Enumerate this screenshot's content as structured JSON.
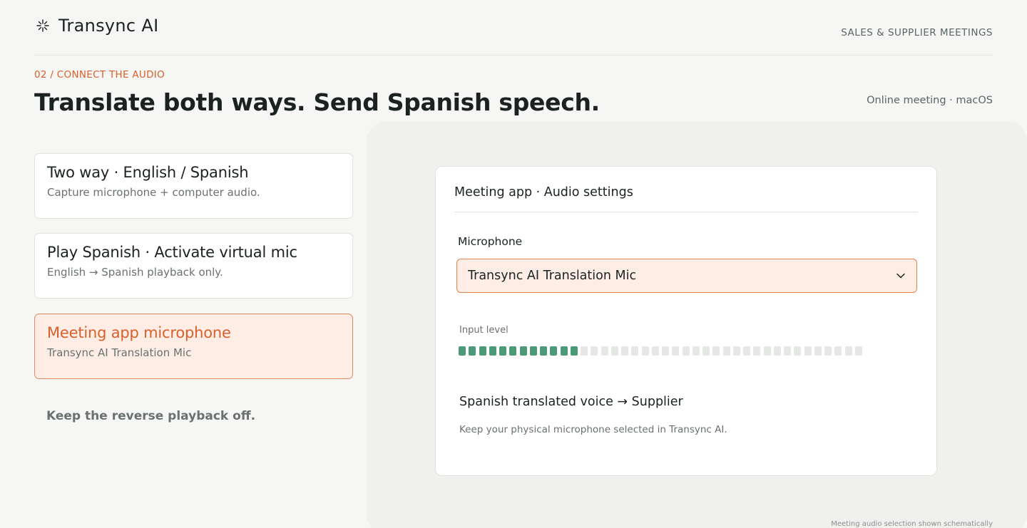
{
  "header": {
    "brand": "Transync AI",
    "context": "SALES & SUPPLIER MEETINGS",
    "brand_icon": "sparkle-logo-icon"
  },
  "step": {
    "label": "02 / CONNECT THE AUDIO",
    "title": "Translate both ways. Send Spanish speech.",
    "meta": "Online meeting · macOS"
  },
  "options": [
    {
      "title": "Two way · English / Spanish",
      "subtitle": "Capture microphone + computer audio.",
      "active": false
    },
    {
      "title": "Play Spanish · Activate virtual mic",
      "subtitle": "English → Spanish playback only.",
      "active": false
    },
    {
      "title": "Meeting app microphone",
      "subtitle": "Transync AI Translation Mic",
      "active": true
    }
  ],
  "note": "Keep the reverse playback off.",
  "panel": {
    "title": "Meeting app · Audio settings",
    "microphone_label": "Microphone",
    "microphone_value": "Transync AI Translation Mic",
    "input_level_label": "Input level",
    "input_level": {
      "active_segments": 12,
      "total_segments": 40
    },
    "route_title": "Spanish translated voice → Supplier",
    "route_subtitle": "Keep your physical microphone selected in Transync AI."
  },
  "footnote": "Meeting audio selection shown schematically",
  "colors": {
    "accent": "#d8602d",
    "accent_bg": "#fdede5",
    "level_on": "#4c9a78",
    "level_off": "#e6e8e5"
  }
}
